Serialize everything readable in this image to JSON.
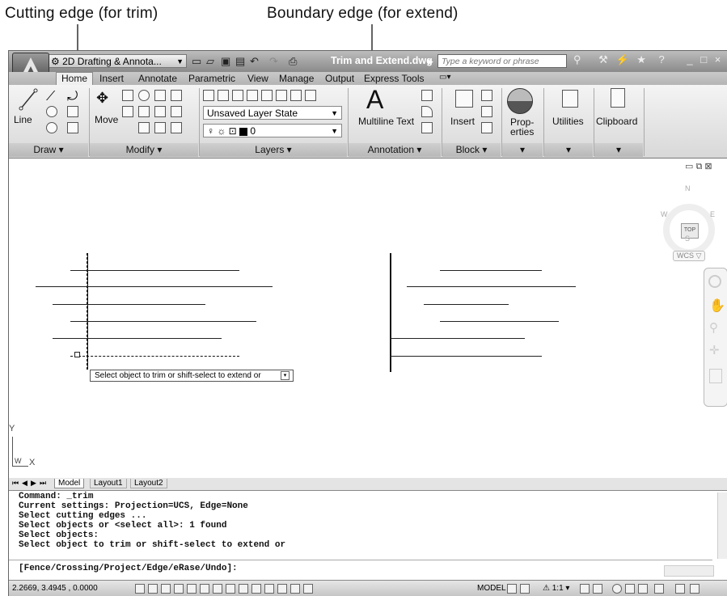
{
  "callouts": {
    "cutting_edge": "Cutting edge (for trim)",
    "boundary_edge": "Boundary edge (for extend)"
  },
  "titlebar": {
    "workspace": "2D Drafting & Annota...",
    "title": "Trim and Extend.dwg",
    "search_placeholder": "Type a keyword or phrase"
  },
  "tabs": [
    "Home",
    "Insert",
    "Annotate",
    "Parametric",
    "View",
    "Manage",
    "Output",
    "Express Tools"
  ],
  "ribbon": {
    "draw": {
      "label": "Draw",
      "line": "Line"
    },
    "modify": {
      "label": "Modify",
      "move": "Move"
    },
    "layers": {
      "label": "Layers",
      "layer_state": "Unsaved Layer State",
      "current_layer": "0"
    },
    "annotation": {
      "label": "Annotation",
      "multiline_text": "Multiline Text"
    },
    "block": {
      "label": "Block",
      "insert": "Insert"
    },
    "properties": {
      "line1": "Prop-",
      "line2": "erties"
    },
    "utilities": "Utilities",
    "clipboard": "Clipboard"
  },
  "viewcube": {
    "top": "TOP",
    "n": "N",
    "s": "S",
    "e": "E",
    "w": "W",
    "wcs": "WCS"
  },
  "canvas": {
    "tooltip": "Select object to trim or shift-select to extend or",
    "ucs_y": "Y",
    "ucs_x": "X",
    "ucs_w": "W"
  },
  "layout_tabs": [
    "Model",
    "Layout1",
    "Layout2"
  ],
  "command_lines": [
    "Command: _trim",
    "Current settings: Projection=UCS, Edge=None",
    "Select cutting edges ...",
    "Select objects or <select all>: 1 found",
    "Select objects:",
    "Select object to trim or shift-select to extend or",
    "",
    "[Fence/Crossing/Project/Edge/eRase/Undo]:"
  ],
  "status": {
    "coords": "2.2669, 3.4945 , 0.0000",
    "model": "MODEL",
    "scale": "1:1"
  }
}
